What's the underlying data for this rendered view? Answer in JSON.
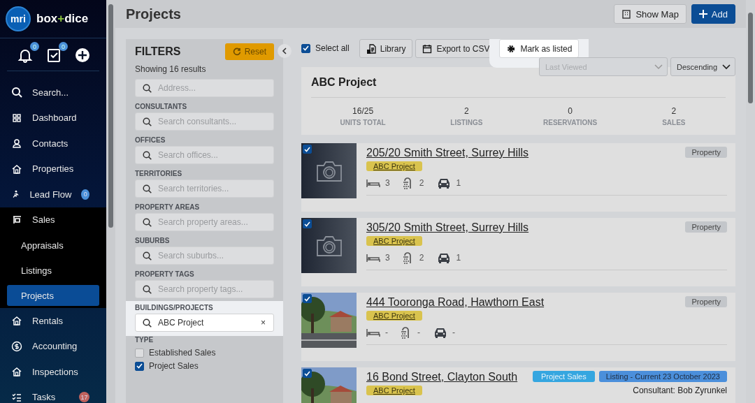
{
  "brand": {
    "logo": "mri",
    "name_left": "box",
    "name_plus": "+",
    "name_right": "dice"
  },
  "top_icons": [
    {
      "kind": "bell",
      "badge": "0"
    },
    {
      "kind": "tasks",
      "badge": "0"
    },
    {
      "kind": "add"
    }
  ],
  "nav": [
    {
      "kind": "search",
      "label": "Search...",
      "selected": false
    },
    {
      "kind": "item",
      "label": "Dashboard",
      "selected": false
    },
    {
      "kind": "item",
      "label": "Contacts",
      "selected": false
    },
    {
      "kind": "item",
      "label": "Properties",
      "selected": false
    },
    {
      "kind": "item",
      "label": "Lead Flow",
      "badge": "0",
      "color": "#4a90d9",
      "selected": false
    },
    {
      "kind": "section",
      "label": "Sales",
      "selected": false
    },
    {
      "kind": "sub",
      "label": "Appraisals",
      "selected": false
    },
    {
      "kind": "sub",
      "label": "Listings",
      "selected": false
    },
    {
      "kind": "sub",
      "label": "Projects",
      "selected": true
    },
    {
      "kind": "item",
      "label": "Rentals",
      "selected": false
    },
    {
      "kind": "item",
      "label": "Accounting",
      "selected": false
    },
    {
      "kind": "item",
      "label": "Inspections",
      "selected": false
    },
    {
      "kind": "item",
      "label": "Tasks",
      "badge": "17",
      "color": "#c0625e",
      "selected": false
    }
  ],
  "page_title": "Projects",
  "header_buttons": [
    {
      "kind": "map",
      "label": "Show Map"
    },
    {
      "kind": "add",
      "label": "Add"
    }
  ],
  "filters": {
    "title": "FILTERS",
    "reset": "Reset",
    "results": "Showing 16 results",
    "fields": [
      {
        "placeholder": "Address...",
        "highlighted": false
      },
      {
        "heading": "CONSULTANTS",
        "placeholder": "Search consultants...",
        "highlighted": false
      },
      {
        "heading": "OFFICES",
        "placeholder": "Search offices...",
        "highlighted": false
      },
      {
        "heading": "TERRITORIES",
        "placeholder": "Search territories...",
        "highlighted": false
      },
      {
        "heading": "PROPERTY AREAS",
        "placeholder": "Search property areas...",
        "highlighted": false
      },
      {
        "heading": "SUBURBS",
        "placeholder": "Search suburbs...",
        "highlighted": false
      },
      {
        "heading": "PROPERTY TAGS",
        "placeholder": "Search property tags...",
        "highlighted": false
      },
      {
        "heading": "BUILDINGS/PROJECTS",
        "value": "ABC Project",
        "clear": "×",
        "highlighted": true
      }
    ],
    "type_heading": "TYPE",
    "types": [
      {
        "label": "Established Sales",
        "checked": false
      },
      {
        "label": "Project Sales",
        "checked": true
      }
    ]
  },
  "toolbar": {
    "select_all": {
      "label": "Select all",
      "checked": true
    },
    "buttons": [
      {
        "kind": "library",
        "label": "Library",
        "highlighted": false
      },
      {
        "kind": "csv",
        "label": "Export to CSV",
        "highlighted": false
      },
      {
        "kind": "listed",
        "label": "Mark as listed",
        "highlighted": true
      }
    ],
    "sort_field": {
      "placeholder": "Last Viewed"
    },
    "sort_order": {
      "value": "Descending"
    }
  },
  "project": {
    "title": "ABC Project",
    "stats": [
      {
        "value": "16/25",
        "label": "UNITS TOTAL"
      },
      {
        "value": "2",
        "label": "LISTINGS"
      },
      {
        "value": "0",
        "label": "RESERVATIONS"
      },
      {
        "value": "2",
        "label": "SALES"
      }
    ]
  },
  "listings": [
    {
      "kind": "placeholder",
      "checked": true,
      "title": "205/20 Smith Street, Surrey Hills",
      "tag": "ABC Project",
      "badges": [
        {
          "kind": "grey",
          "label": "Property"
        }
      ],
      "beds": "3",
      "baths": "2",
      "cars": "1"
    },
    {
      "kind": "placeholder",
      "checked": true,
      "title": "305/20 Smith Street, Surrey Hills",
      "tag": "ABC Project",
      "badges": [
        {
          "kind": "grey",
          "label": "Property"
        }
      ],
      "beds": "3",
      "baths": "2",
      "cars": "1"
    },
    {
      "kind": "picture",
      "checked": true,
      "title": "444 Tooronga Road, Hawthorn East",
      "tag": "ABC Project",
      "badges": [
        {
          "kind": "grey",
          "label": "Property"
        }
      ],
      "beds": "-",
      "baths": "-",
      "cars": "-"
    },
    {
      "kind": "picture",
      "checked": true,
      "title": "16 Bond Street, Clayton South",
      "tag": "ABC Project",
      "badges": [
        {
          "kind": "teal",
          "label": "Project Sales"
        },
        {
          "kind": "blue",
          "label": "Listing - Current 23 October 2023"
        }
      ],
      "consultant": "Consultant: Bob Zyrunkel"
    }
  ]
}
